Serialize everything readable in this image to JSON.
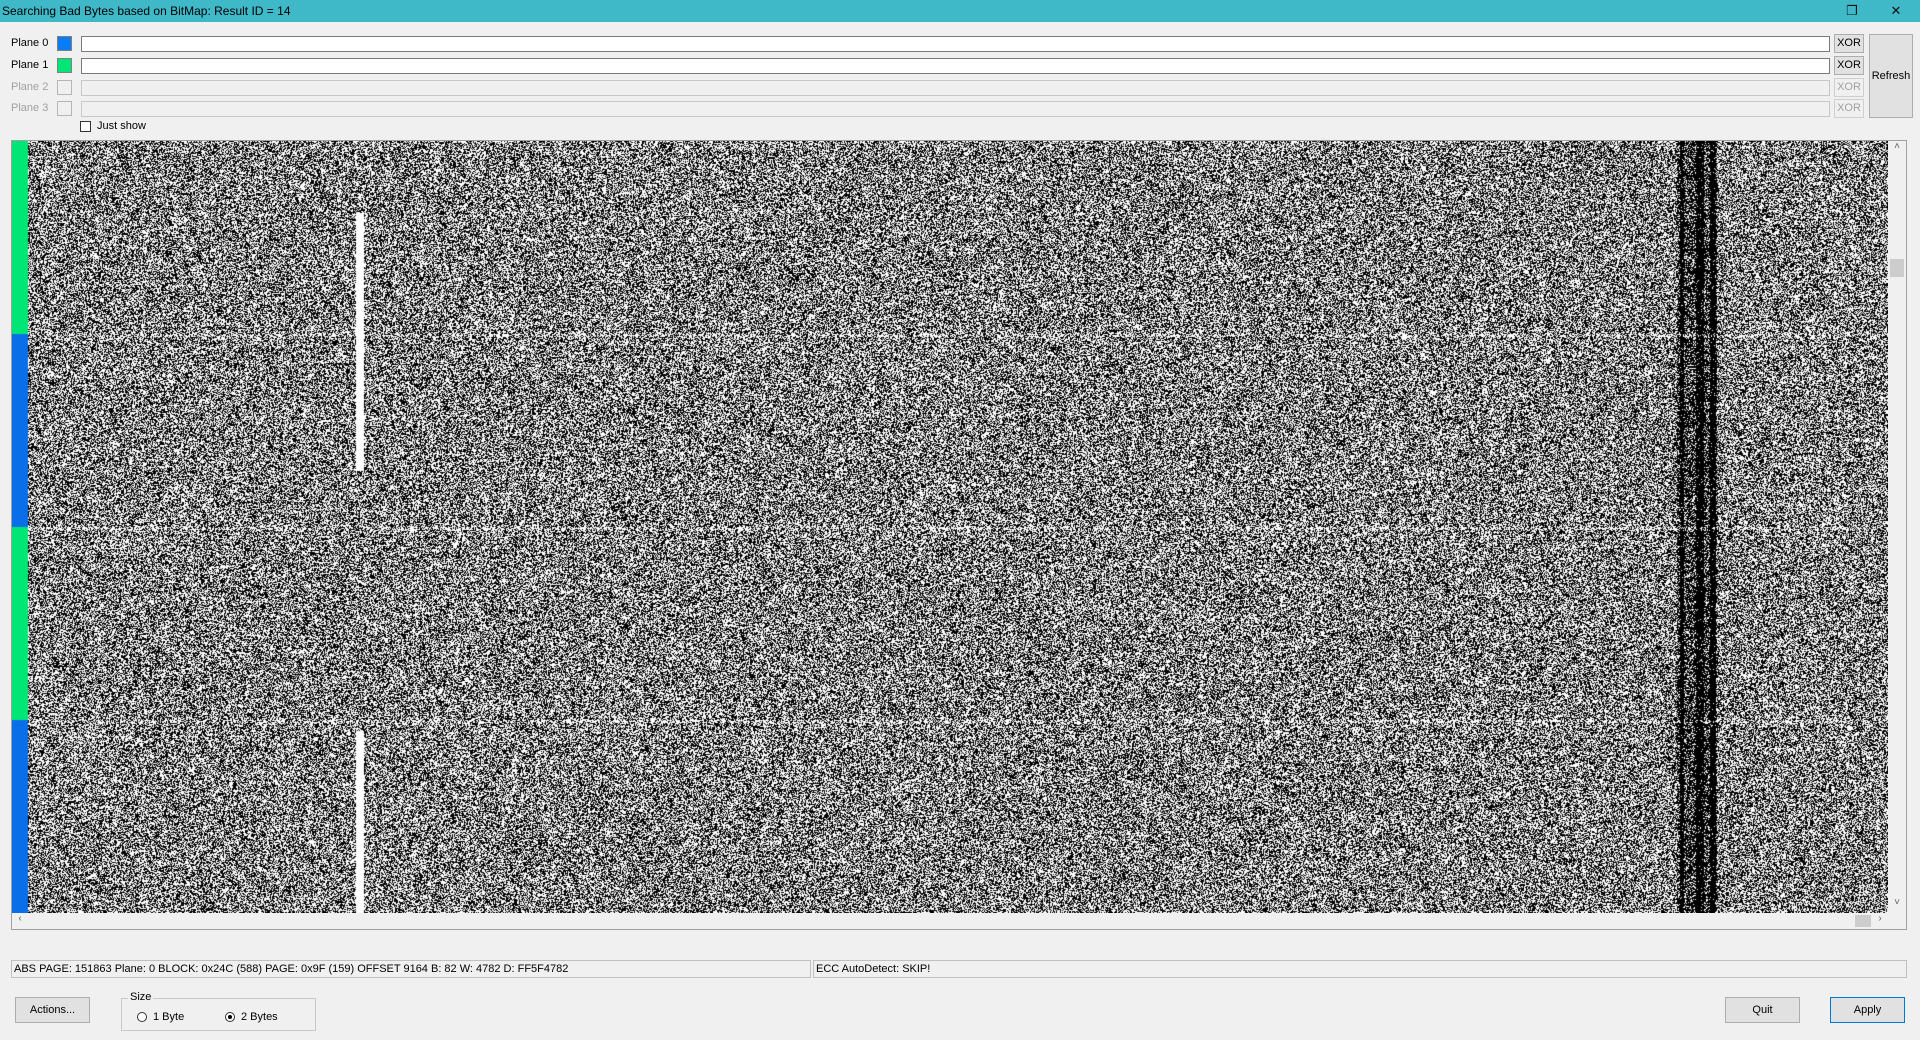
{
  "window": {
    "title": "Searching Bad Bytes based on BitMap: Result ID = 14",
    "restore_glyph": "❐",
    "close_glyph": "✕"
  },
  "planes": [
    {
      "label": "Plane 0",
      "color": "#0a7cf5",
      "enabled": true,
      "xor": "XOR"
    },
    {
      "label": "Plane 1",
      "color": "#00e676",
      "enabled": true,
      "xor": "XOR"
    },
    {
      "label": "Plane 2",
      "color": "",
      "enabled": false,
      "xor": "XOR"
    },
    {
      "label": "Plane 3",
      "color": "",
      "enabled": false,
      "xor": "XOR"
    }
  ],
  "refresh_label": "Refresh",
  "just_show": {
    "label": "Just show",
    "checked": false
  },
  "bitmap": {
    "plane_color_sequence": [
      "green",
      "blue",
      "green",
      "blue"
    ],
    "colors": {
      "blue": "#0a6ee8",
      "green": "#00e676",
      "pixel_on": "#000000",
      "pixel_off": "#ffffff"
    }
  },
  "scroll": {
    "up": "˄",
    "down": "˅",
    "left": "‹",
    "right": "›"
  },
  "status": {
    "left": "ABS PAGE: 151863   Plane: 0   BLOCK: 0x24C (588)   PAGE: 0x9F (159)   OFFSET 9164        B: 82  W: 4782  D: FF5F4782",
    "right": "ECC AutoDetect: SKIP!"
  },
  "buttons": {
    "actions": "Actions...",
    "quit": "Quit",
    "apply": "Apply"
  },
  "size_group": {
    "legend": "Size",
    "options": [
      {
        "label": "1 Byte",
        "checked": false
      },
      {
        "label": "2 Bytes",
        "checked": true
      }
    ]
  }
}
